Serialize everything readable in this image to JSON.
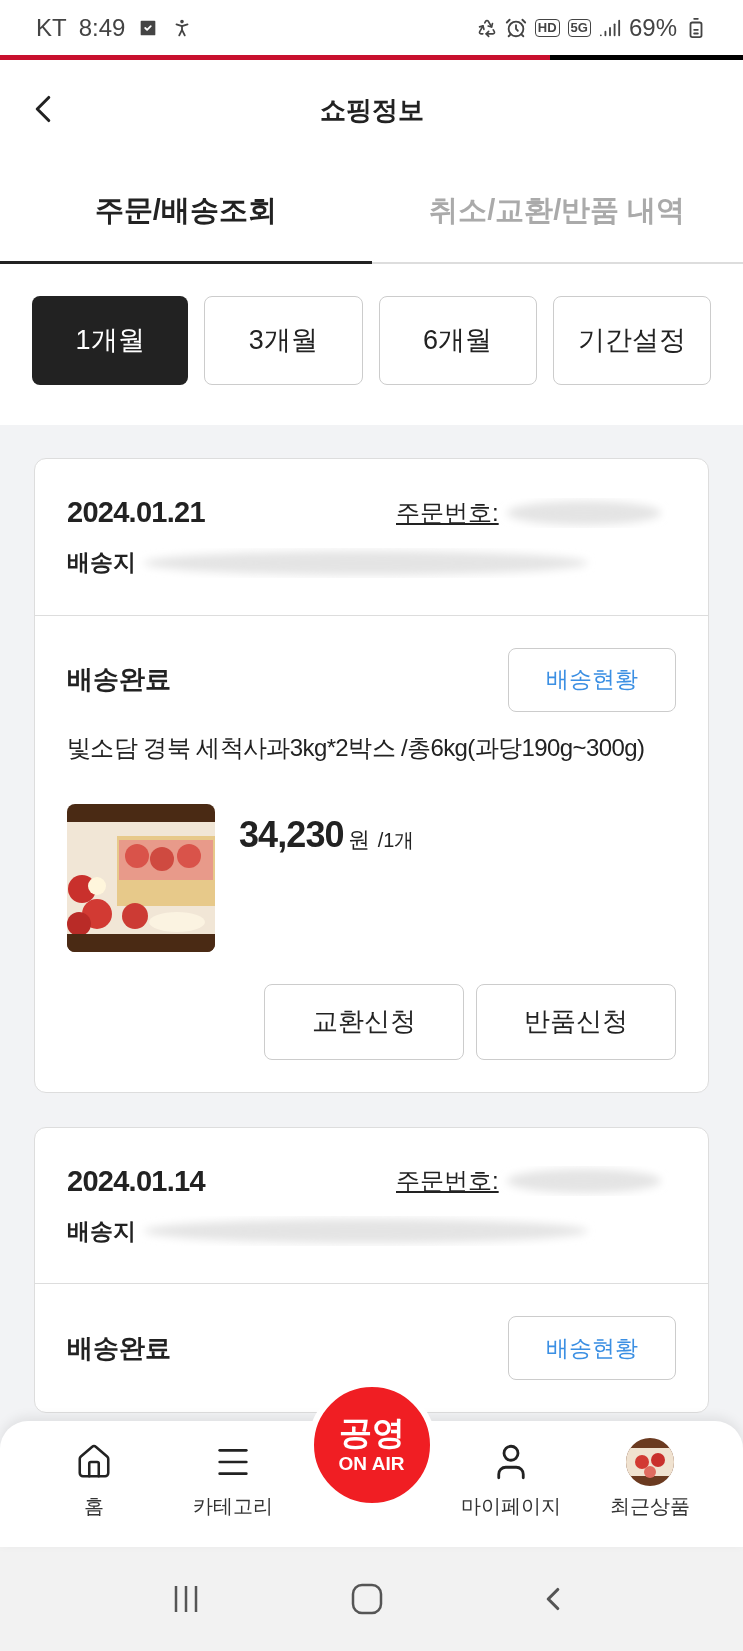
{
  "status_bar": {
    "carrier": "KT",
    "time": "8:49",
    "badges": [
      "HD",
      "5G"
    ],
    "battery": "69%"
  },
  "page_progress": {
    "level": 0.74
  },
  "header": {
    "title": "쇼핑정보"
  },
  "tabs": [
    {
      "label": "주문/배송조회",
      "selected": true
    },
    {
      "label": "취소/교환/반품 내역",
      "selected": false
    }
  ],
  "periods": [
    {
      "label": "1개월",
      "selected": true
    },
    {
      "label": "3개월",
      "selected": false
    },
    {
      "label": "6개월",
      "selected": false
    },
    {
      "label": "기간설정",
      "selected": false
    }
  ],
  "orders": [
    {
      "date": "2024.01.21",
      "order_no_label": "주문번호:",
      "address_label": "배송지",
      "status": "배송완료",
      "tracking_button": "배송현황",
      "product": "빛소담 경북 세척사과3kg*2박스 /총6kg(과당190g~300g)",
      "price": "34,230",
      "currency": "원",
      "quantity": "/1개",
      "actions": [
        "교환신청",
        "반품신청"
      ]
    },
    {
      "date": "2024.01.14",
      "order_no_label": "주문번호:",
      "address_label": "배송지",
      "status": "배송완료",
      "tracking_button": "배송현황"
    }
  ],
  "bottom_nav": [
    {
      "label": "홈",
      "kind": "home"
    },
    {
      "label": "카테고리",
      "kind": "menu"
    },
    {
      "label": "공영",
      "sublabel": "ON AIR",
      "kind": "live"
    },
    {
      "label": "마이페이지",
      "kind": "user"
    },
    {
      "label": "최근상품",
      "kind": "recent"
    }
  ]
}
